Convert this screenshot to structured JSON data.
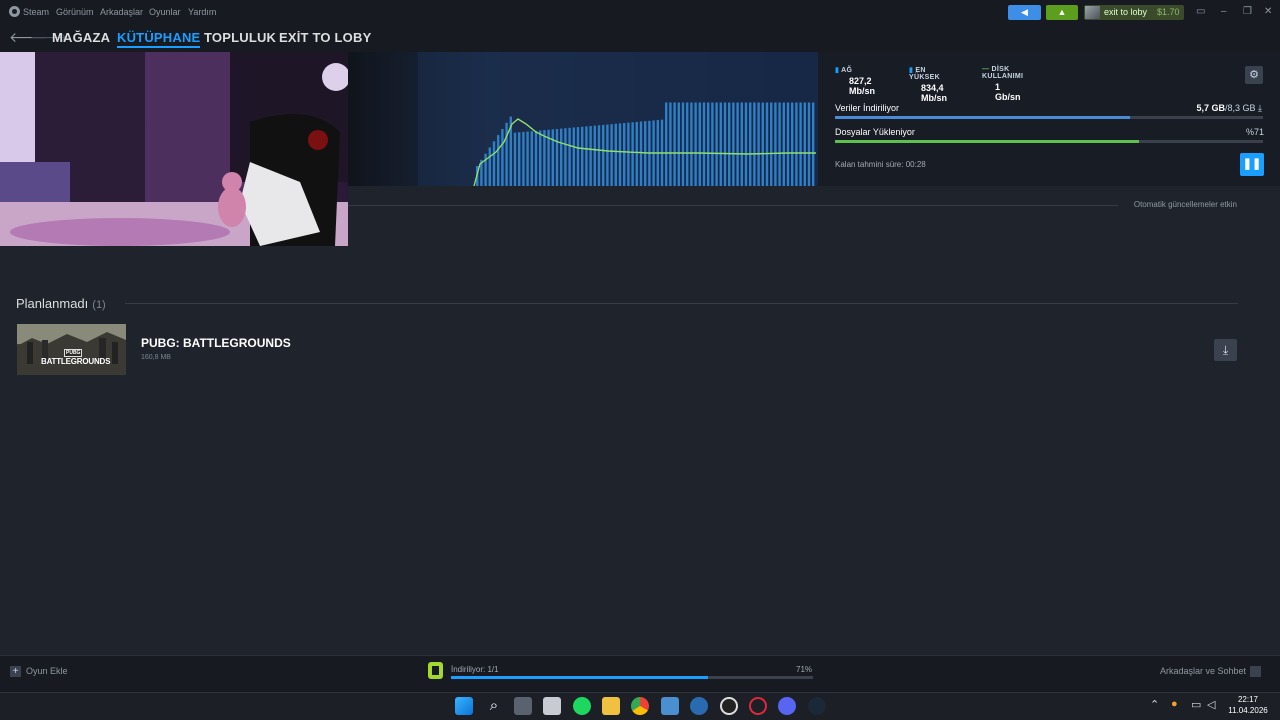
{
  "menubar": {
    "items": [
      "Steam",
      "Görünüm",
      "Arkadaşlar",
      "Oyunlar",
      "Yardım"
    ],
    "user": {
      "name": "exit to loby",
      "balance": "$1.70"
    }
  },
  "nav": {
    "back_icon": "arrow-left-icon",
    "forward_icon": "arrow-right-icon",
    "links": [
      "MAĞAZA",
      "KÜTÜPHANE",
      "TOPLULUK",
      "EXİT TO LOBY"
    ],
    "active": "KÜTÜPHANE"
  },
  "downloads": {
    "stats": [
      {
        "key": "AĞ",
        "value": "827,2 Mb/sn"
      },
      {
        "key": "EN YÜKSEK",
        "value": "834,4 Mb/sn"
      },
      {
        "key": "DİSK KULLANIMI",
        "value": "1 Gb/sn"
      }
    ],
    "downloading": {
      "label": "Veriler İndiriliyor",
      "done": "5,7 GB",
      "total": "/8,3 GB",
      "progress": 0.69
    },
    "installing": {
      "label": "Dosyalar Yükleniyor",
      "percent": "%71",
      "progress": 0.71
    },
    "eta": "Kalan tahmini süre: 00:28",
    "auto_updates": "Otomatik güncellemeler etkin",
    "colors": {
      "download_bar": "#4b8bd6",
      "install_bar": "#5ec14e",
      "accent": "#1a9fff"
    }
  },
  "queue": {
    "section_title": "Planlanmadı",
    "count": "(1)",
    "game": {
      "name": "PUBG: BATTLEGROUNDS",
      "size": "160,8 MB",
      "card_pubg": "PUBG",
      "card_logo": "BATTLEGROUNDS"
    }
  },
  "statusbar": {
    "add_game": "Oyun Ekle",
    "downloading": "İndiriliyor: 1/1",
    "percent": "71%",
    "progress": 0.71,
    "friends": "Arkadaşlar ve Sohbet"
  },
  "taskbar": {
    "clock_time": "22:17",
    "clock_date": "11.04.2026"
  }
}
